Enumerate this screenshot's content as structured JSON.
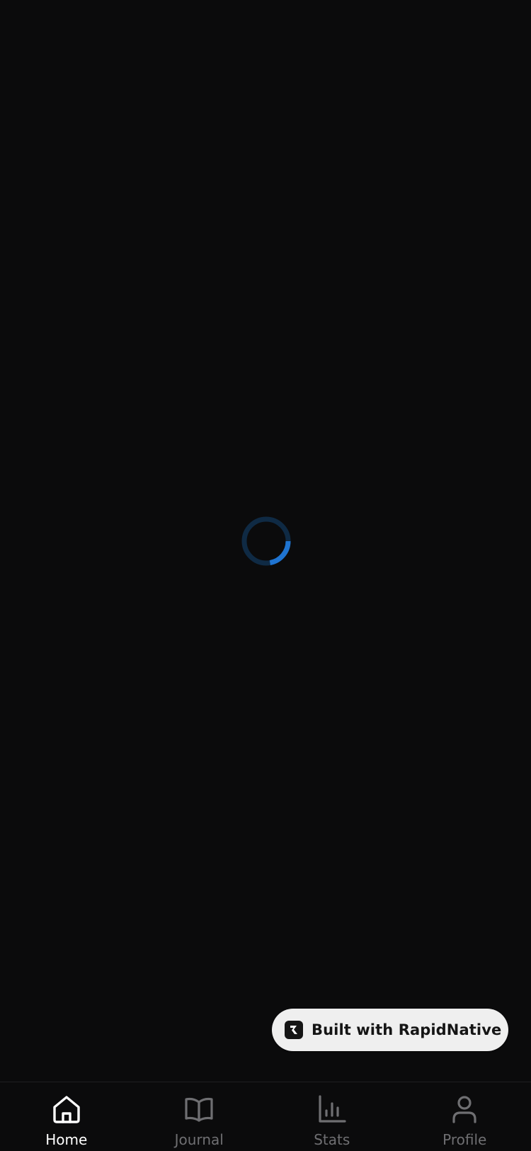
{
  "colors": {
    "background": "#0b0b0c",
    "spinner_track": "#0f2a44",
    "spinner_arc": "#1f74d1",
    "badge_background": "#efefef",
    "tab_active": "#ffffff",
    "tab_inactive": "#6f6f72"
  },
  "loading": {
    "icon": "loading-spinner-icon"
  },
  "badge": {
    "label": "Built with RapidNative",
    "icon": "rapidnative-logo-icon"
  },
  "tabbar": {
    "tabs": [
      {
        "label": "Home",
        "icon": "home-icon",
        "active": true
      },
      {
        "label": "Journal",
        "icon": "book-open-icon",
        "active": false
      },
      {
        "label": "Stats",
        "icon": "bar-chart-icon",
        "active": false
      },
      {
        "label": "Profile",
        "icon": "user-icon",
        "active": false
      }
    ]
  }
}
